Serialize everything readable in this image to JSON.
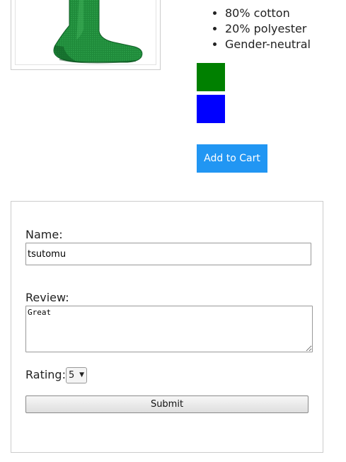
{
  "product": {
    "image_icon": "green-sock-image",
    "features": [
      "80% cotton",
      "20% polyester",
      "Gender-neutral"
    ],
    "colors": {
      "swatches": [
        {
          "name": "green",
          "hex": "#008000"
        },
        {
          "name": "blue",
          "hex": "#0000ff"
        }
      ]
    },
    "add_to_cart_label": "Add to Cart",
    "add_to_cart_color": "#2196f3"
  },
  "review_form": {
    "name_label": "Name:",
    "name_value": "tsutomu",
    "review_label": "Review:",
    "review_value": "Great",
    "rating_label": "Rating:",
    "rating_value": "5",
    "submit_label": "Submit"
  }
}
